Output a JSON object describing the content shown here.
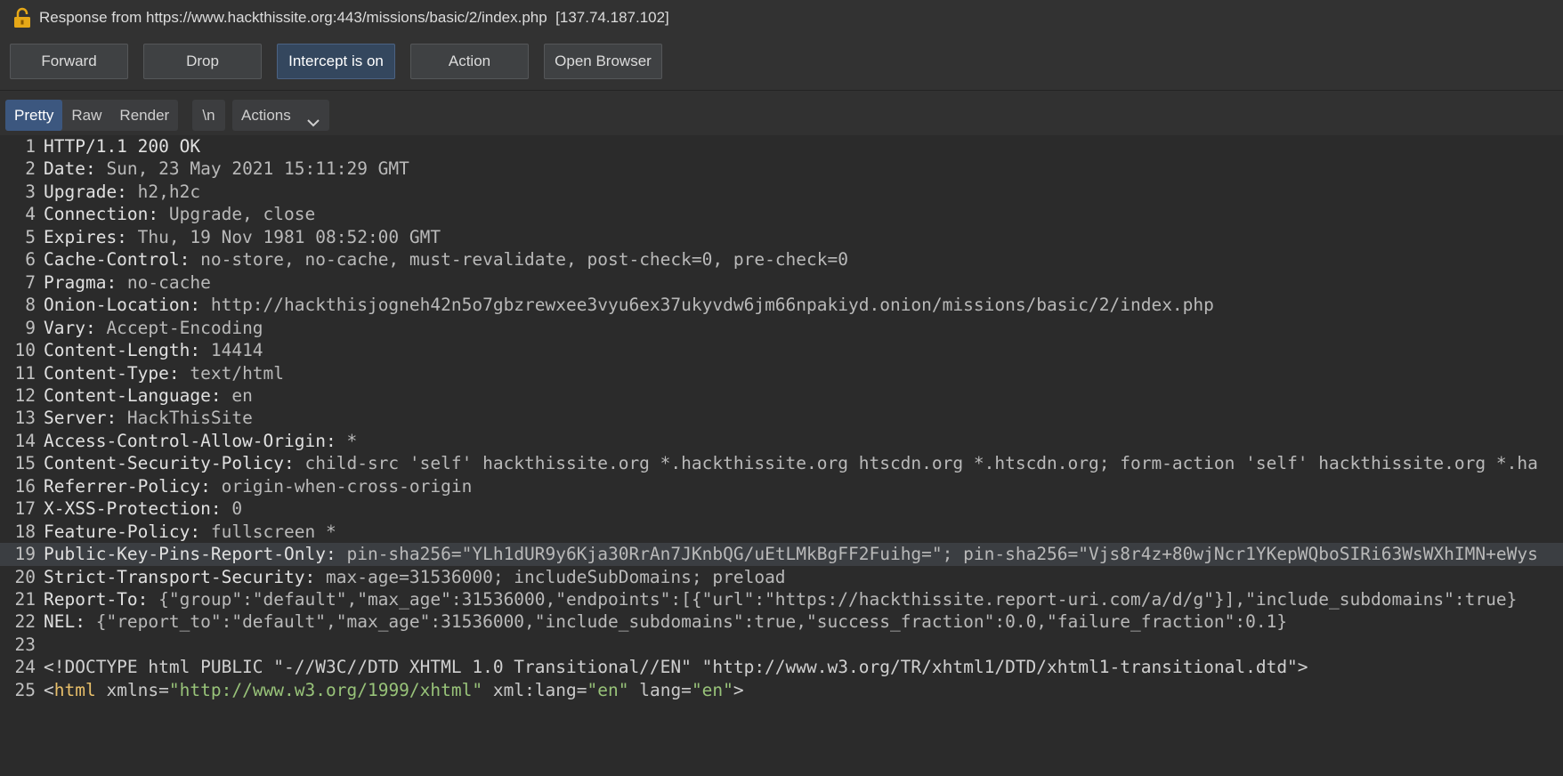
{
  "window": {
    "title": "Response from https://www.hackthissite.org:443/missions/basic/2/index.php  [137.74.187.102]",
    "lock_icon": "lock-icon",
    "lock_color": "#e6a817"
  },
  "toolbar": {
    "forward_label": "Forward",
    "drop_label": "Drop",
    "intercept_label": "Intercept is on",
    "action_label": "Action",
    "open_browser_label": "Open Browser"
  },
  "view_tabs": {
    "pretty": "Pretty",
    "raw": "Raw",
    "render": "Render",
    "newline": "\\n",
    "actions": "Actions",
    "actions_icon": "chevron-down-icon"
  },
  "colors": {
    "background": "#2b2b2b",
    "active_tab": "#3c577f",
    "intercept_active": "#34475e",
    "highlight_line": "#3b3e42",
    "html_tag": "#e8bf6a",
    "html_attr_value": "#98c379"
  },
  "editor": {
    "highlighted_line": 19,
    "lines": [
      {
        "n": "1",
        "parts": [
          {
            "t": "HTTP/1.1 200 OK",
            "c": "hk"
          }
        ]
      },
      {
        "n": "2",
        "parts": [
          {
            "t": "Date:",
            "c": "hk"
          },
          {
            "t": " Sun, 23 May 2021 15:11:29 GMT",
            "c": "hv"
          }
        ]
      },
      {
        "n": "3",
        "parts": [
          {
            "t": "Upgrade:",
            "c": "hk"
          },
          {
            "t": " h2,h2c",
            "c": "hv"
          }
        ]
      },
      {
        "n": "4",
        "parts": [
          {
            "t": "Connection:",
            "c": "hk"
          },
          {
            "t": " Upgrade, close",
            "c": "hv"
          }
        ]
      },
      {
        "n": "5",
        "parts": [
          {
            "t": "Expires:",
            "c": "hk"
          },
          {
            "t": " Thu, 19 Nov 1981 08:52:00 GMT",
            "c": "hv"
          }
        ]
      },
      {
        "n": "6",
        "parts": [
          {
            "t": "Cache-Control:",
            "c": "hk"
          },
          {
            "t": " no-store, no-cache, must-revalidate, post-check=0, pre-check=0",
            "c": "hv"
          }
        ]
      },
      {
        "n": "7",
        "parts": [
          {
            "t": "Pragma:",
            "c": "hk"
          },
          {
            "t": " no-cache",
            "c": "hv"
          }
        ]
      },
      {
        "n": "8",
        "parts": [
          {
            "t": "Onion-Location:",
            "c": "hk"
          },
          {
            "t": " http://hackthisjogneh42n5o7gbzrewxee3vyu6ex37ukyvdw6jm66npakiyd.onion/missions/basic/2/index.php",
            "c": "hv"
          }
        ]
      },
      {
        "n": "9",
        "parts": [
          {
            "t": "Vary:",
            "c": "hk"
          },
          {
            "t": " Accept-Encoding",
            "c": "hv"
          }
        ]
      },
      {
        "n": "10",
        "parts": [
          {
            "t": "Content-Length:",
            "c": "hk"
          },
          {
            "t": " 14414",
            "c": "hv"
          }
        ]
      },
      {
        "n": "11",
        "parts": [
          {
            "t": "Content-Type:",
            "c": "hk"
          },
          {
            "t": " text/html",
            "c": "hv"
          }
        ]
      },
      {
        "n": "12",
        "parts": [
          {
            "t": "Content-Language:",
            "c": "hk"
          },
          {
            "t": " en",
            "c": "hv"
          }
        ]
      },
      {
        "n": "13",
        "parts": [
          {
            "t": "Server:",
            "c": "hk"
          },
          {
            "t": " HackThisSite",
            "c": "hv"
          }
        ]
      },
      {
        "n": "14",
        "parts": [
          {
            "t": "Access-Control-Allow-Origin:",
            "c": "hk"
          },
          {
            "t": " *",
            "c": "hv"
          }
        ]
      },
      {
        "n": "15",
        "parts": [
          {
            "t": "Content-Security-Policy:",
            "c": "hk"
          },
          {
            "t": " child-src 'self' hackthissite.org *.hackthissite.org htscdn.org *.htscdn.org; form-action 'self' hackthissite.org *.ha",
            "c": "hv"
          }
        ]
      },
      {
        "n": "16",
        "parts": [
          {
            "t": "Referrer-Policy:",
            "c": "hk"
          },
          {
            "t": " origin-when-cross-origin",
            "c": "hv"
          }
        ]
      },
      {
        "n": "17",
        "parts": [
          {
            "t": "X-XSS-Protection:",
            "c": "hk"
          },
          {
            "t": " 0",
            "c": "hv"
          }
        ]
      },
      {
        "n": "18",
        "parts": [
          {
            "t": "Feature-Policy:",
            "c": "hk"
          },
          {
            "t": " fullscreen *",
            "c": "hv"
          }
        ]
      },
      {
        "n": "19",
        "parts": [
          {
            "t": "Public-Key-Pins-Report-Only:",
            "c": "hk"
          },
          {
            "t": " pin-sha256=\"YLh1dUR9y6Kja30RrAn7JKnbQG/uEtLMkBgFF2Fuihg=\"; pin-sha256=\"Vjs8r4z+80wjNcr1YKepWQboSIRi63WsWXhIMN+eWys",
            "c": "hv"
          }
        ]
      },
      {
        "n": "20",
        "parts": [
          {
            "t": "Strict-Transport-Security:",
            "c": "hk"
          },
          {
            "t": " max-age=31536000; includeSubDomains; preload",
            "c": "hv"
          }
        ]
      },
      {
        "n": "21",
        "parts": [
          {
            "t": "Report-To:",
            "c": "hk"
          },
          {
            "t": " {\"group\":\"default\",\"max_age\":31536000,\"endpoints\":[{\"url\":\"https://hackthissite.report-uri.com/a/d/g\"}],\"include_subdomains\":true}",
            "c": "hv"
          }
        ]
      },
      {
        "n": "22",
        "parts": [
          {
            "t": "NEL:",
            "c": "hk"
          },
          {
            "t": " {\"report_to\":\"default\",\"max_age\":31536000,\"include_subdomains\":true,\"success_fraction\":0.0,\"failure_fraction\":0.1}",
            "c": "hv"
          }
        ]
      },
      {
        "n": "23",
        "parts": []
      },
      {
        "n": "24",
        "parts": [
          {
            "t": "<!DOCTYPE html PUBLIC \"-//W3C//DTD XHTML 1.0 Transitional//EN\" \"http://www.w3.org/TR/xhtml1/DTD/xhtml1-transitional.dtd\">",
            "c": "pl"
          }
        ]
      },
      {
        "n": "25",
        "parts": [
          {
            "t": "<",
            "c": "pl"
          },
          {
            "t": "html",
            "c": "tg"
          },
          {
            "t": " xmlns=",
            "c": "at"
          },
          {
            "t": "\"http://www.w3.org/1999/xhtml\"",
            "c": "av"
          },
          {
            "t": " xml:lang=",
            "c": "at"
          },
          {
            "t": "\"en\"",
            "c": "av"
          },
          {
            "t": " lang=",
            "c": "at"
          },
          {
            "t": "\"en\"",
            "c": "av"
          },
          {
            "t": ">",
            "c": "pl"
          }
        ]
      }
    ]
  }
}
